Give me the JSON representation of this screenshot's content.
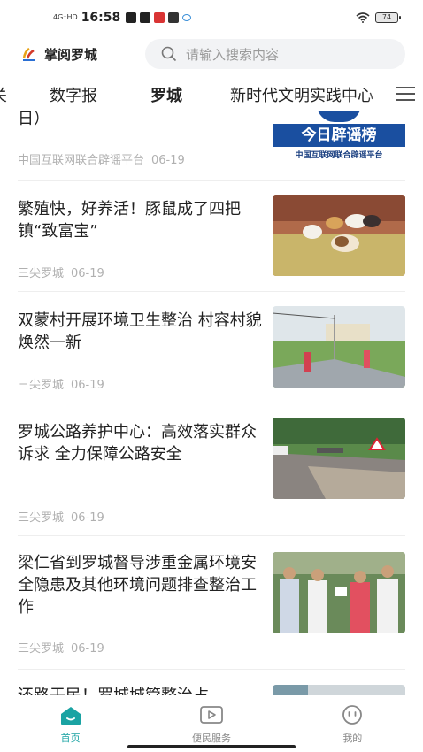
{
  "status_bar": {
    "network": "4G⁺HD",
    "time": "16:58",
    "battery": "74"
  },
  "header": {
    "app_name": "掌阅罗城",
    "search_placeholder": "请输入搜索内容"
  },
  "tabs": [
    {
      "label": "关",
      "active": false
    },
    {
      "label": "数字报",
      "active": false
    },
    {
      "label": "罗城",
      "active": true
    },
    {
      "label": "新时代文明实践中心",
      "active": false
    }
  ],
  "news": [
    {
      "title": "日）",
      "source": "中国互联网联合辟谣平台",
      "date": "06-19",
      "thumb": "rumor-banner",
      "thumb_text": "今日辟谣榜",
      "thumb_sub": "中国互联网联合辟谣平台"
    },
    {
      "title": "繁殖快，好养活！豚鼠成了四把镇“致富宝”",
      "source": "三尖罗城",
      "date": "06-19",
      "thumb": "guinea-pigs"
    },
    {
      "title": "双蒙村开展环境卫生整治 村容村貌焕然一新",
      "source": "三尖罗城",
      "date": "06-19",
      "thumb": "village-road"
    },
    {
      "title": "罗城公路养护中心：高效落实群众诉求 全力保障公路安全",
      "source": "三尖罗城",
      "date": "06-19",
      "thumb": "highway"
    },
    {
      "title": "梁仁省到罗城督导涉重金属环境安全隐患及其他环境问题排查整治工作",
      "source": "三尖罗城",
      "date": "06-19",
      "thumb": "inspection"
    },
    {
      "title": "还路于民！罗城城管整治占",
      "source": "",
      "date": "",
      "thumb": "partial"
    }
  ],
  "bottom_nav": [
    {
      "label": "首页",
      "icon": "home-icon",
      "active": true
    },
    {
      "label": "便民服务",
      "icon": "play-icon",
      "active": false
    },
    {
      "label": "我的",
      "icon": "profile-icon",
      "active": false
    }
  ],
  "colors": {
    "accent": "#1aa3a3",
    "rumor_blue": "#1a4fa0"
  }
}
